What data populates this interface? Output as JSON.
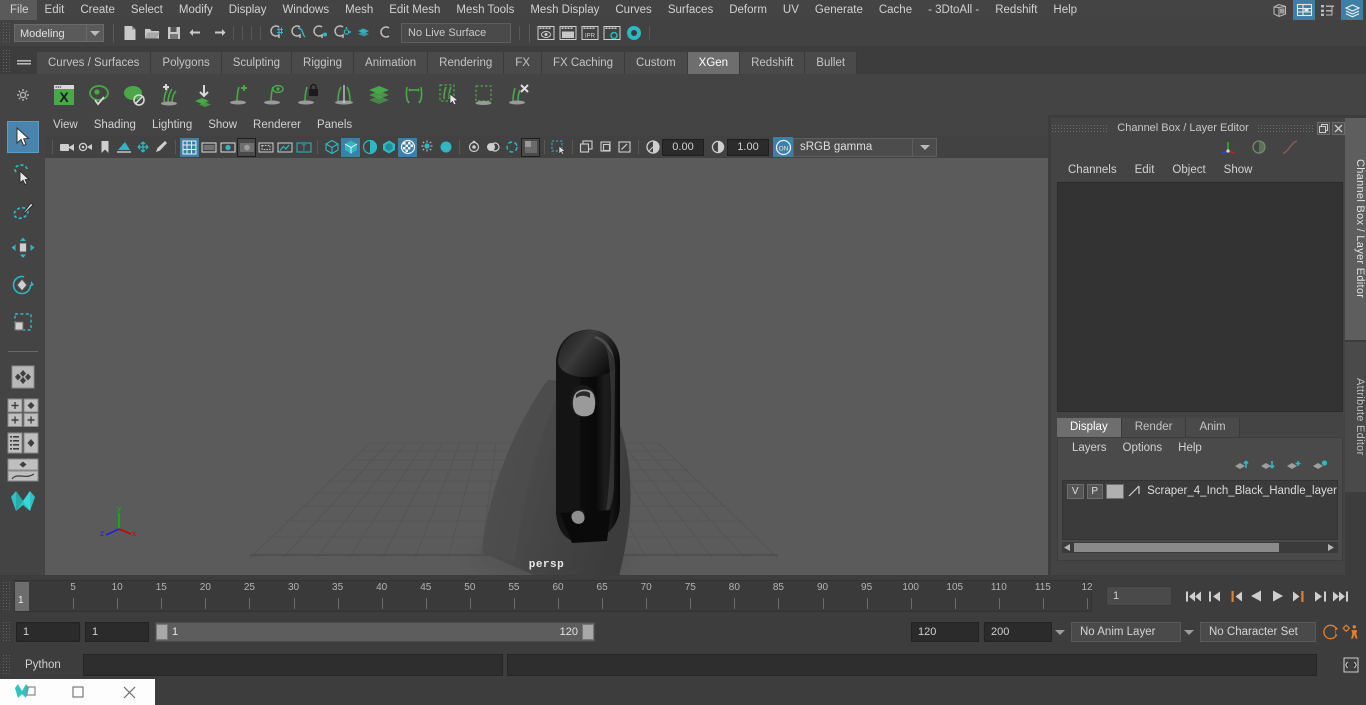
{
  "menubar": {
    "items": [
      "File",
      "Edit",
      "Create",
      "Select",
      "Modify",
      "Display",
      "Windows",
      "Mesh",
      "Edit Mesh",
      "Mesh Tools",
      "Mesh Display",
      "Curves",
      "Surfaces",
      "Deform",
      "UV",
      "Generate",
      "Cache",
      "- 3DtoAll -",
      "Redshift",
      "Help"
    ],
    "right_icons": [
      "modeling-toolkit-icon",
      "channel-box-toggle-icon",
      "attribute-editor-toggle-icon",
      "layer-editor-toggle-icon"
    ]
  },
  "statusline": {
    "menu_set": "Modeling",
    "live_surface": "No Live Surface",
    "snap_icons": [
      "snap-to-grid-icon",
      "snap-to-curve-icon",
      "snap-to-point-icon",
      "snap-to-projected-center-icon",
      "snap-to-view-plane-icon",
      "make-live-icon"
    ],
    "file_icons": [
      "new-scene-icon",
      "open-scene-icon",
      "save-scene-icon",
      "undo-icon",
      "redo-icon"
    ],
    "render_icons": [
      "render-current-frame-icon",
      "render-sequence-icon",
      "ipr-render-icon",
      "render-settings-icon",
      "hypershade-icon"
    ],
    "exposure_value": "0.00",
    "gamma_value": "1.00",
    "view_transform": "sRGB gamma",
    "color_toggle": "ON"
  },
  "shelf": {
    "tabs": [
      "Curves / Surfaces",
      "Polygons",
      "Sculpting",
      "Rigging",
      "Animation",
      "Rendering",
      "FX",
      "FX Caching",
      "Custom",
      "XGen",
      "Redshift",
      "Bullet"
    ],
    "active_tab": "XGen",
    "icons": [
      "xgen-window-icon",
      "xgen-preview-icon",
      "xgen-render-icon",
      "xgen-add-description-icon",
      "xgen-import-collection-icon",
      "xgen-add-guide-icon",
      "xgen-show-guide-icon",
      "xgen-lock-guide-icon",
      "xgen-mirror-guide-icon",
      "xgen-sculpt-layers-icon",
      "xgen-convert-to-interactive-icon",
      "xgen-select-guides-icon",
      "xgen-region-mask-icon",
      "xgen-delete-guide-icon"
    ]
  },
  "toolbox": {
    "tools": [
      {
        "name": "select-tool",
        "selected": true
      },
      {
        "name": "lasso-select-tool",
        "selected": false
      },
      {
        "name": "paint-select-tool",
        "selected": false
      },
      {
        "name": "move-tool",
        "selected": false
      },
      {
        "name": "rotate-tool",
        "selected": false
      },
      {
        "name": "scale-tool",
        "selected": false
      }
    ],
    "last_tool": "last-tool-used-icon",
    "layouts": [
      "single-perspective-layout",
      "four-view-layout",
      "outliner-persp-layout",
      "hypergraph-persp-layout",
      "persp-graph-layout"
    ]
  },
  "viewport_panel": {
    "menus": [
      "View",
      "Shading",
      "Lighting",
      "Show",
      "Renderer",
      "Panels"
    ],
    "toolbar_icons": [
      "select-camera-icon",
      "camera-attributes-icon",
      "bookmark-icon",
      "image-plane-icon",
      "two-d-pan-zoom-icon",
      "grease-pencil-icon",
      "grid-toggle-icon",
      "film-gate-icon",
      "resolution-gate-icon",
      "gate-mask-icon",
      "field-chart-icon",
      "safe-action-icon",
      "safe-title-icon",
      "wireframe-icon",
      "smooth-shade-all-icon",
      "shaded-wireframe-icon",
      "textured-icon",
      "use-all-lights-icon",
      "shadows-icon",
      "screen-space-ao-icon",
      "motion-blur-icon",
      "multisample-aa-icon",
      "depth-of-field-icon",
      "isolate-select-icon",
      "xray-icon",
      "xray-joints-icon",
      "xray-active-components-icon",
      "exposure-icon",
      "gamma-icon"
    ],
    "exposure": "0.00",
    "gamma": "1.00",
    "camera_label": "persp",
    "axis_labels": {
      "x": "x",
      "y": "y",
      "z": "z"
    },
    "background_color": "#5b5b5b",
    "grid_color": "#545454",
    "model": {
      "name": "Scraper 4 Inch Black Handle",
      "handle_color": "#0b0b0b",
      "blade_color": "#4a4a4a"
    }
  },
  "right_panel": {
    "title": "Channel Box / Layer Editor",
    "window_buttons": [
      "undock-icon",
      "close-icon"
    ],
    "header_icons": [
      "manipulator-icon",
      "display-toggle-icon",
      "spline-icon"
    ],
    "channel_menus": [
      "Channels",
      "Edit",
      "Object",
      "Show"
    ],
    "layer_editor": {
      "tabs": [
        "Display",
        "Render",
        "Anim"
      ],
      "active_tab": "Display",
      "menus": [
        "Layers",
        "Options",
        "Help"
      ],
      "buttons": [
        "move-layer-up-icon",
        "move-layer-down-icon",
        "create-empty-layer-icon",
        "create-layer-from-selected-icon"
      ],
      "layers": [
        {
          "visibility": "V",
          "playback": "P",
          "color": "",
          "name": "Scraper_4_Inch_Black_Handle_layer"
        }
      ]
    },
    "side_tabs": [
      {
        "label": "Channel Box / Layer Editor",
        "active": true
      },
      {
        "label": "Attribute Editor",
        "active": false
      }
    ]
  },
  "time_slider": {
    "tick_labels": [
      "5",
      "10",
      "15",
      "20",
      "25",
      "30",
      "35",
      "40",
      "45",
      "50",
      "55",
      "60",
      "65",
      "70",
      "75",
      "80",
      "85",
      "90",
      "95",
      "100",
      "105",
      "110",
      "115",
      "12"
    ],
    "current_frame_marker": "1",
    "current_frame": "1",
    "playback_buttons": [
      "go-to-start-icon",
      "step-back-frame-icon",
      "step-back-key-icon",
      "play-backwards-icon",
      "play-forwards-icon",
      "step-forward-key-icon",
      "step-forward-frame-icon",
      "go-to-end-icon"
    ]
  },
  "range_slider": {
    "anim_start": "1",
    "range_start": "1",
    "bar_start_label": "1",
    "bar_end_label": "120",
    "range_end": "120",
    "anim_end": "200",
    "anim_layer": "No Anim Layer",
    "character_set": "No Character Set",
    "right_icons": [
      "auto-key-icon",
      "animation-preferences-icon"
    ]
  },
  "command_line": {
    "language": "Python",
    "input_value": "",
    "output_value": ""
  },
  "taskbar": {
    "items": [
      "maya-app-icon",
      "restore-window-icon",
      "close-window-icon"
    ]
  },
  "colors": {
    "accent_teal": "#2eb8c4",
    "shelf_green": "#4aa84a",
    "highlight_blue": "#4884ab",
    "orange": "#e08030",
    "panel_bg": "#444444",
    "viewport_bg": "#5b5b5b"
  }
}
